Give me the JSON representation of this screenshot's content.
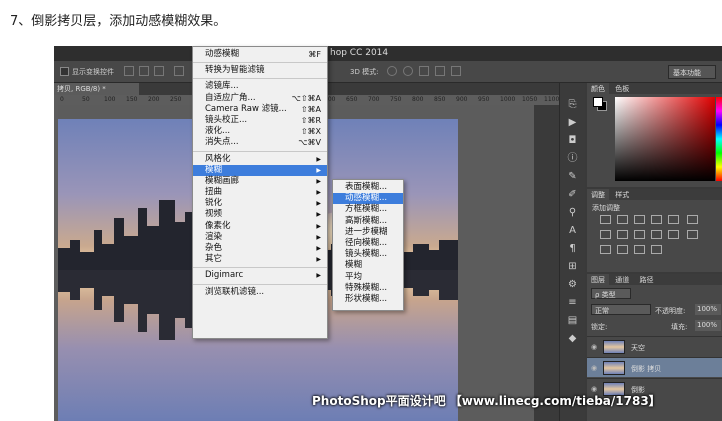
{
  "caption": "7、倒影拷贝层，添加动感模糊效果。",
  "app": {
    "title_fragment": "hop CC 2014",
    "options_bar": {
      "show_transform": "显示变换控件",
      "mode_label": "3D 模式:",
      "workspace": "基本功能"
    },
    "doc_tab": "拷贝, RGB/8) *",
    "ruler_ticks": [
      "0",
      "50",
      "100",
      "150",
      "200",
      "250",
      "300",
      "350",
      "400",
      "450",
      "500",
      "550",
      "600",
      "650",
      "700",
      "750",
      "800",
      "850",
      "900",
      "950",
      "1000",
      "1050",
      "1100"
    ]
  },
  "filter_menu": {
    "items": [
      {
        "label": "动感模糊",
        "shortcut": "⌘F"
      },
      {
        "sep": true
      },
      {
        "label": "转换为智能滤镜"
      },
      {
        "sep": true
      },
      {
        "label": "滤镜库..."
      },
      {
        "label": "自适应广角...",
        "shortcut": "⌥⇧⌘A"
      },
      {
        "label": "Camera Raw 滤镜...",
        "shortcut": "⇧⌘A"
      },
      {
        "label": "镜头校正...",
        "shortcut": "⇧⌘R"
      },
      {
        "label": "液化...",
        "shortcut": "⇧⌘X"
      },
      {
        "label": "消失点...",
        "shortcut": "⌥⌘V"
      },
      {
        "sep": true
      },
      {
        "label": "风格化",
        "submenu": true
      },
      {
        "label": "模糊",
        "submenu": true,
        "highlight": true
      },
      {
        "label": "模糊画廊",
        "submenu": true
      },
      {
        "label": "扭曲",
        "submenu": true
      },
      {
        "label": "锐化",
        "submenu": true
      },
      {
        "label": "视频",
        "submenu": true
      },
      {
        "label": "像素化",
        "submenu": true
      },
      {
        "label": "渲染",
        "submenu": true
      },
      {
        "label": "杂色",
        "submenu": true
      },
      {
        "label": "其它",
        "submenu": true
      },
      {
        "sep": true
      },
      {
        "label": "Digimarc",
        "submenu": true
      },
      {
        "sep": true
      },
      {
        "label": "浏览联机滤镜..."
      }
    ]
  },
  "blur_submenu": {
    "items": [
      {
        "label": "表面模糊..."
      },
      {
        "label": "动感模糊...",
        "highlight": true
      },
      {
        "label": "方框模糊..."
      },
      {
        "label": "高斯模糊..."
      },
      {
        "label": "进一步模糊"
      },
      {
        "label": "径向模糊..."
      },
      {
        "label": "镜头模糊..."
      },
      {
        "label": "模糊"
      },
      {
        "label": "平均"
      },
      {
        "label": "特殊模糊..."
      },
      {
        "label": "形状模糊..."
      }
    ]
  },
  "panels": {
    "color_tabs": [
      "颜色",
      "色板"
    ],
    "adjust_tabs": [
      "调整",
      "样式"
    ],
    "adjust_title": "添加调整",
    "layer_tabs": [
      "图层",
      "通道",
      "路径"
    ],
    "kind_filter": "ρ 类型",
    "blend_mode": "正常",
    "opacity_label": "不透明度:",
    "opacity_value": "100%",
    "lock_label": "锁定:",
    "fill_label": "填充:",
    "fill_value": "100%",
    "layers": [
      {
        "name": "天空"
      },
      {
        "name": "倒影 拷贝",
        "selected": true
      },
      {
        "name": "倒影"
      }
    ]
  },
  "watermark": "PhotoShop平面设计吧 【www.linecg.com/tieba/1783】"
}
